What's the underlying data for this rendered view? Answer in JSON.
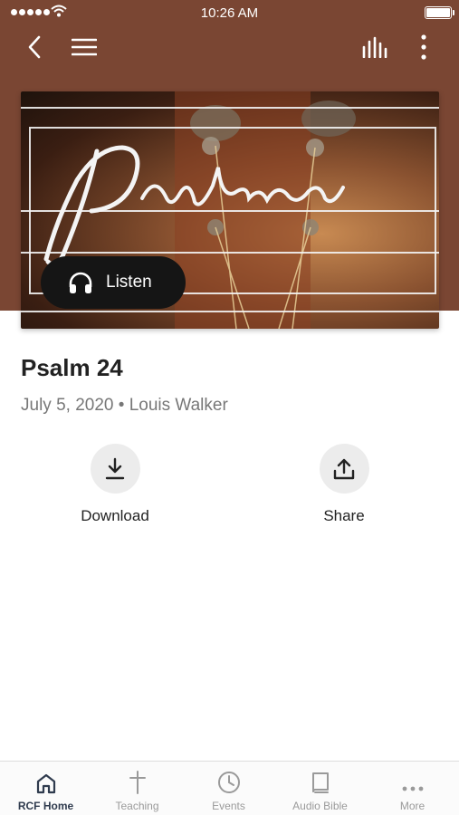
{
  "status_bar": {
    "time": "10:26 AM"
  },
  "nav": {
    "back_icon": "chevron-left-icon",
    "menu_icon": "hamburger-icon",
    "audio_icon": "equalizer-icon",
    "more_icon": "vertical-dots-icon"
  },
  "hero": {
    "listen_label": "Listen",
    "listen_icon": "headphones-icon"
  },
  "sermon": {
    "title": "Psalm 24",
    "date": "July 5, 2020",
    "separator": "•",
    "speaker": "Louis Walker"
  },
  "actions": [
    {
      "label": "Download",
      "icon": "download-icon"
    },
    {
      "label": "Share",
      "icon": "share-icon"
    }
  ],
  "tabs": [
    {
      "label": "RCF Home",
      "icon": "home-icon",
      "active": true
    },
    {
      "label": "Teaching",
      "icon": "cross-icon",
      "active": false
    },
    {
      "label": "Events",
      "icon": "clock-icon",
      "active": false
    },
    {
      "label": "Audio Bible",
      "icon": "book-icon",
      "active": false
    },
    {
      "label": "More",
      "icon": "horizontal-dots-icon",
      "active": false
    }
  ],
  "colors": {
    "header_brown": "#7a4633",
    "tab_active": "#2f3b4e",
    "tab_inactive": "#9a9a9a"
  }
}
